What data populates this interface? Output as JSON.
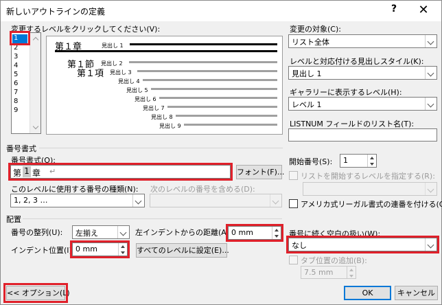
{
  "window": {
    "title": "新しいアウトラインの定義",
    "help": "?",
    "close": "✕"
  },
  "level_section": {
    "label": "変更するレベルをクリックしてください(V):",
    "levels": [
      "1",
      "2",
      "3",
      "4",
      "5",
      "6",
      "7",
      "8",
      "9"
    ],
    "selected": "1"
  },
  "preview": {
    "chapter": "第１章",
    "section": "第１節",
    "item": "第１項",
    "headings": [
      "見出し 1",
      "見出し 2",
      "見出し 3",
      "見出し 4",
      "見出し 5",
      "見出し 6",
      "見出し 7",
      "見出し 8",
      "見出し 9"
    ]
  },
  "right_panel": {
    "target_label": "変更の対象(C):",
    "target_value": "リスト全体",
    "style_label": "レベルと対応付ける見出しスタイル(K):",
    "style_value": "見出し 1",
    "gallery_label": "ギャラリーに表示するレベル(H):",
    "gallery_value": "レベル 1",
    "listnum_label": "LISTNUM フィールドのリスト名(T):",
    "listnum_value": ""
  },
  "number_format": {
    "group_label": "番号書式",
    "format_label": "番号書式(O):",
    "format_prefix": "第",
    "format_number": "1",
    "format_suffix": "章",
    "format_mark": "↵",
    "font_button": "フォント(F)...",
    "kind_label": "このレベルに使用する番号の種類(N):",
    "kind_value": "1, 2, 3 …",
    "include_label": "次のレベルの番号を含める(D):",
    "include_value": "",
    "start_label": "開始番号(S):",
    "start_value": "1",
    "restart_label": "リストを開始するレベルを指定する(R):",
    "restart_value": "",
    "legal_label": "アメリカ式リーガル書式の連番を付ける(G)"
  },
  "layout": {
    "group_label": "配置",
    "align_label": "番号の整列(U):",
    "align_value": "左揃え",
    "indent_from_label": "左インデントからの距離(A):",
    "indent_from_value": "0 mm",
    "indent_pos_label": "インデント位置(I):",
    "indent_pos_value": "0 mm",
    "apply_all_button": "すべてのレベルに設定(E)...",
    "follow_label": "番号に続く空白の扱い(W):",
    "follow_value": "なし",
    "tab_label": "タブ位置の追加(B):",
    "tab_value": "7.5 mm"
  },
  "footer": {
    "options_button": "<< オプション(L)",
    "ok_button": "OK",
    "cancel_button": "キャンセル"
  },
  "colors": {
    "highlight": "#e0202a",
    "selection": "#0078d7"
  }
}
